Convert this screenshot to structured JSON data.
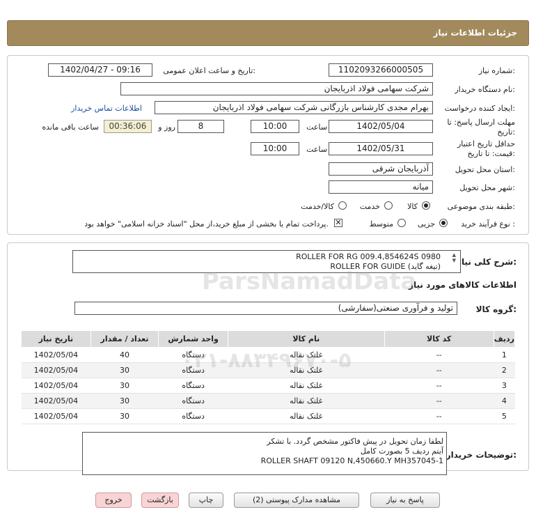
{
  "header": {
    "title": "جزئیات اطلاعات نیاز"
  },
  "form": {
    "need_number_label": "شماره نیاز:",
    "need_number": "1102093266000505",
    "announce_label": "تاریخ و ساعت اعلان عمومی:",
    "announce_value": "1402/04/27 - 09:16",
    "buyer_org_label": "نام دستگاه خریدار:",
    "buyer_org": "شرکت سهامی فولاد اذربایجان",
    "creator_label": "ایجاد کننده درخواست:",
    "creator": "بهرام مجدی کارشناس بازرگانی شرکت سهامی فولاد اذربایجان",
    "contact_link": "اطلاعات تماس خریدار",
    "deadline_label_1": "مهلت ارسال پاسخ: تا",
    "deadline_label_2": "تاریخ:",
    "deadline_date": "1402/05/04",
    "time_label": "ساعت",
    "deadline_time": "10:00",
    "days_value": "8",
    "days_label": "روز و",
    "remaining_time": "00:36:06",
    "remaining_label": "ساعت باقی مانده",
    "validity_label_1": "حداقل تاریخ اعتبار",
    "validity_label_2": "قیمت: تا تاریخ:",
    "validity_date": "1402/05/31",
    "validity_time": "10:00",
    "province_label": "استان محل تحویل:",
    "province": "آذربایجان شرقی",
    "city_label": "شهر محل تحویل:",
    "city": "میانه",
    "category_label": "طبقه بندی موضوعی:",
    "category_goods": "کالا",
    "category_service": "خدمت",
    "category_goods_service": "کالا/خدمت",
    "process_label": "نوع فرآیند خرید :",
    "process_partial": "جزیی",
    "process_medium": "متوسط",
    "payment_note": "پرداخت تمام یا بخشی از مبلغ خرید،از محل \"اسناد خزانه اسلامی\" خواهد بود."
  },
  "summary": {
    "general_desc_label": "شرح کلی نیاز:",
    "general_desc_line1": "ROLLER FOR RG 009.4,854624S 0980",
    "general_desc_line2": "ROLLER FOR GUIDE (تیغه گاید)",
    "goods_info_title": "اطلاعات کالاهای مورد نیاز",
    "goods_group_label": "گروه کالا:",
    "goods_group": "تولید و فرآوری صنعتی(سفارشی)"
  },
  "table": {
    "headers": [
      "ردیف",
      "کد کالا",
      "نام کالا",
      "واحد شمارش",
      "تعداد / مقدار",
      "تاریخ نیاز"
    ],
    "rows": [
      [
        "1",
        "--",
        "غلتک نقاله",
        "دستگاه",
        "40",
        "1402/05/04"
      ],
      [
        "2",
        "--",
        "غلتک نقاله",
        "دستگاه",
        "30",
        "1402/05/04"
      ],
      [
        "3",
        "--",
        "غلتک نقاله",
        "دستگاه",
        "30",
        "1402/05/04"
      ],
      [
        "4",
        "--",
        "غلتک نقاله",
        "دستگاه",
        "30",
        "1402/05/04"
      ],
      [
        "5",
        "--",
        "غلتک نقاله",
        "دستگاه",
        "30",
        "1402/05/04"
      ]
    ]
  },
  "buyer_notes": {
    "label": "توضیحات خریدار:",
    "line1": "لطفا زمان تحویل در پیش فاکتور مشخص گردد. با تشکر",
    "line2": "آیتم ردیف 5 بصورت کامل",
    "line3": "ROLLER SHAFT 09120 N,450660.Y MH357045-1"
  },
  "buttons": {
    "reply": "پاسخ به نیاز",
    "attachments": "مشاهده مدارک پیوستی (2)",
    "print": "چاپ",
    "back": "بازگشت",
    "exit": "خروج"
  },
  "watermark": {
    "brand": "ParsNamadData",
    "phone": "۰۲۱-۸۸۳۴۹۶۷۰-۵"
  }
}
